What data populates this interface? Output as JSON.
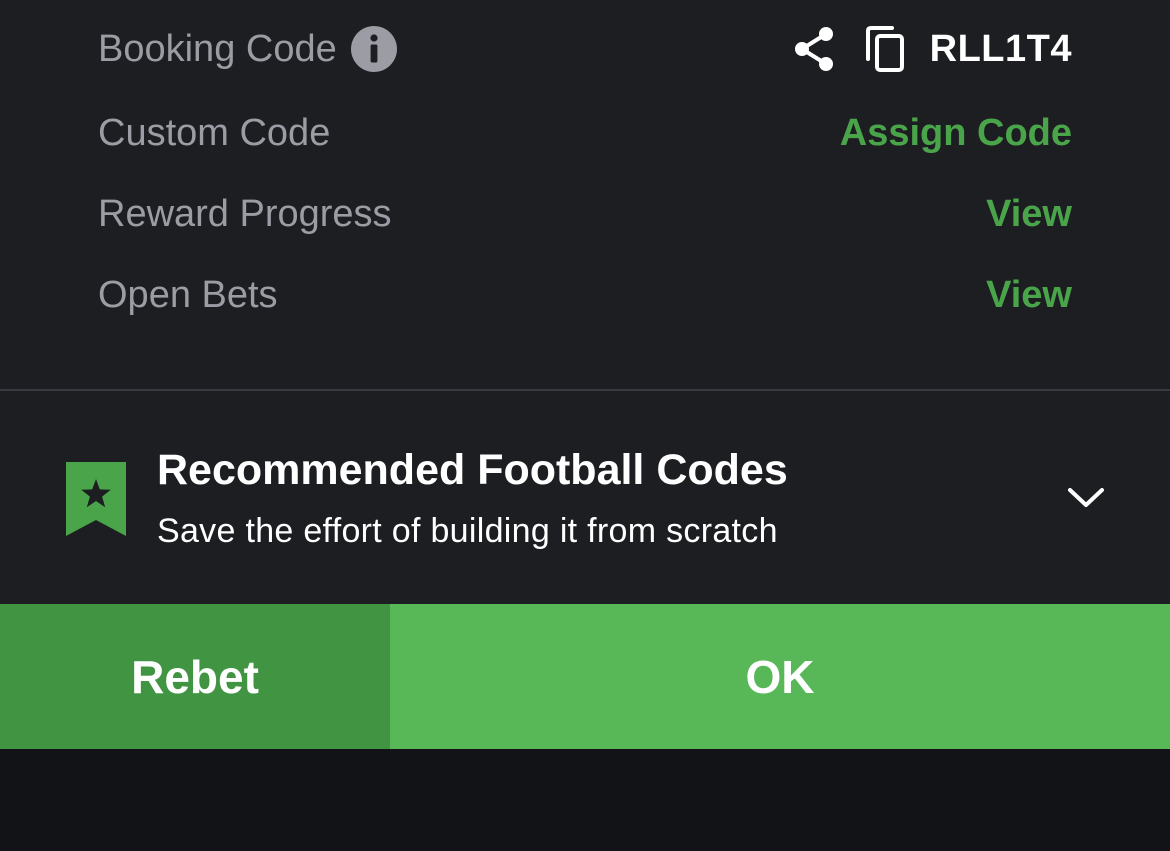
{
  "details": {
    "booking_code": {
      "label": "Booking Code",
      "value": "RLL1T4",
      "icons": [
        "info-icon",
        "share-icon",
        "copy-icon"
      ]
    },
    "custom_code": {
      "label": "Custom Code",
      "action": "Assign Code"
    },
    "reward_progress": {
      "label": "Reward Progress",
      "action": "View"
    },
    "open_bets": {
      "label": "Open Bets",
      "action": "View"
    }
  },
  "recommended": {
    "title": "Recommended Football Codes",
    "subtitle": "Save the effort of building it from scratch",
    "icon": "bookmark-star-icon",
    "toggle_icon": "chevron-down-icon"
  },
  "buttons": {
    "rebet": "Rebet",
    "ok": "OK"
  },
  "colors": {
    "background": "#1d1e22",
    "accent_green": "#4aa54a",
    "rebet_button": "#419441",
    "ok_button": "#58b858",
    "label_gray": "#9b9ca4"
  }
}
